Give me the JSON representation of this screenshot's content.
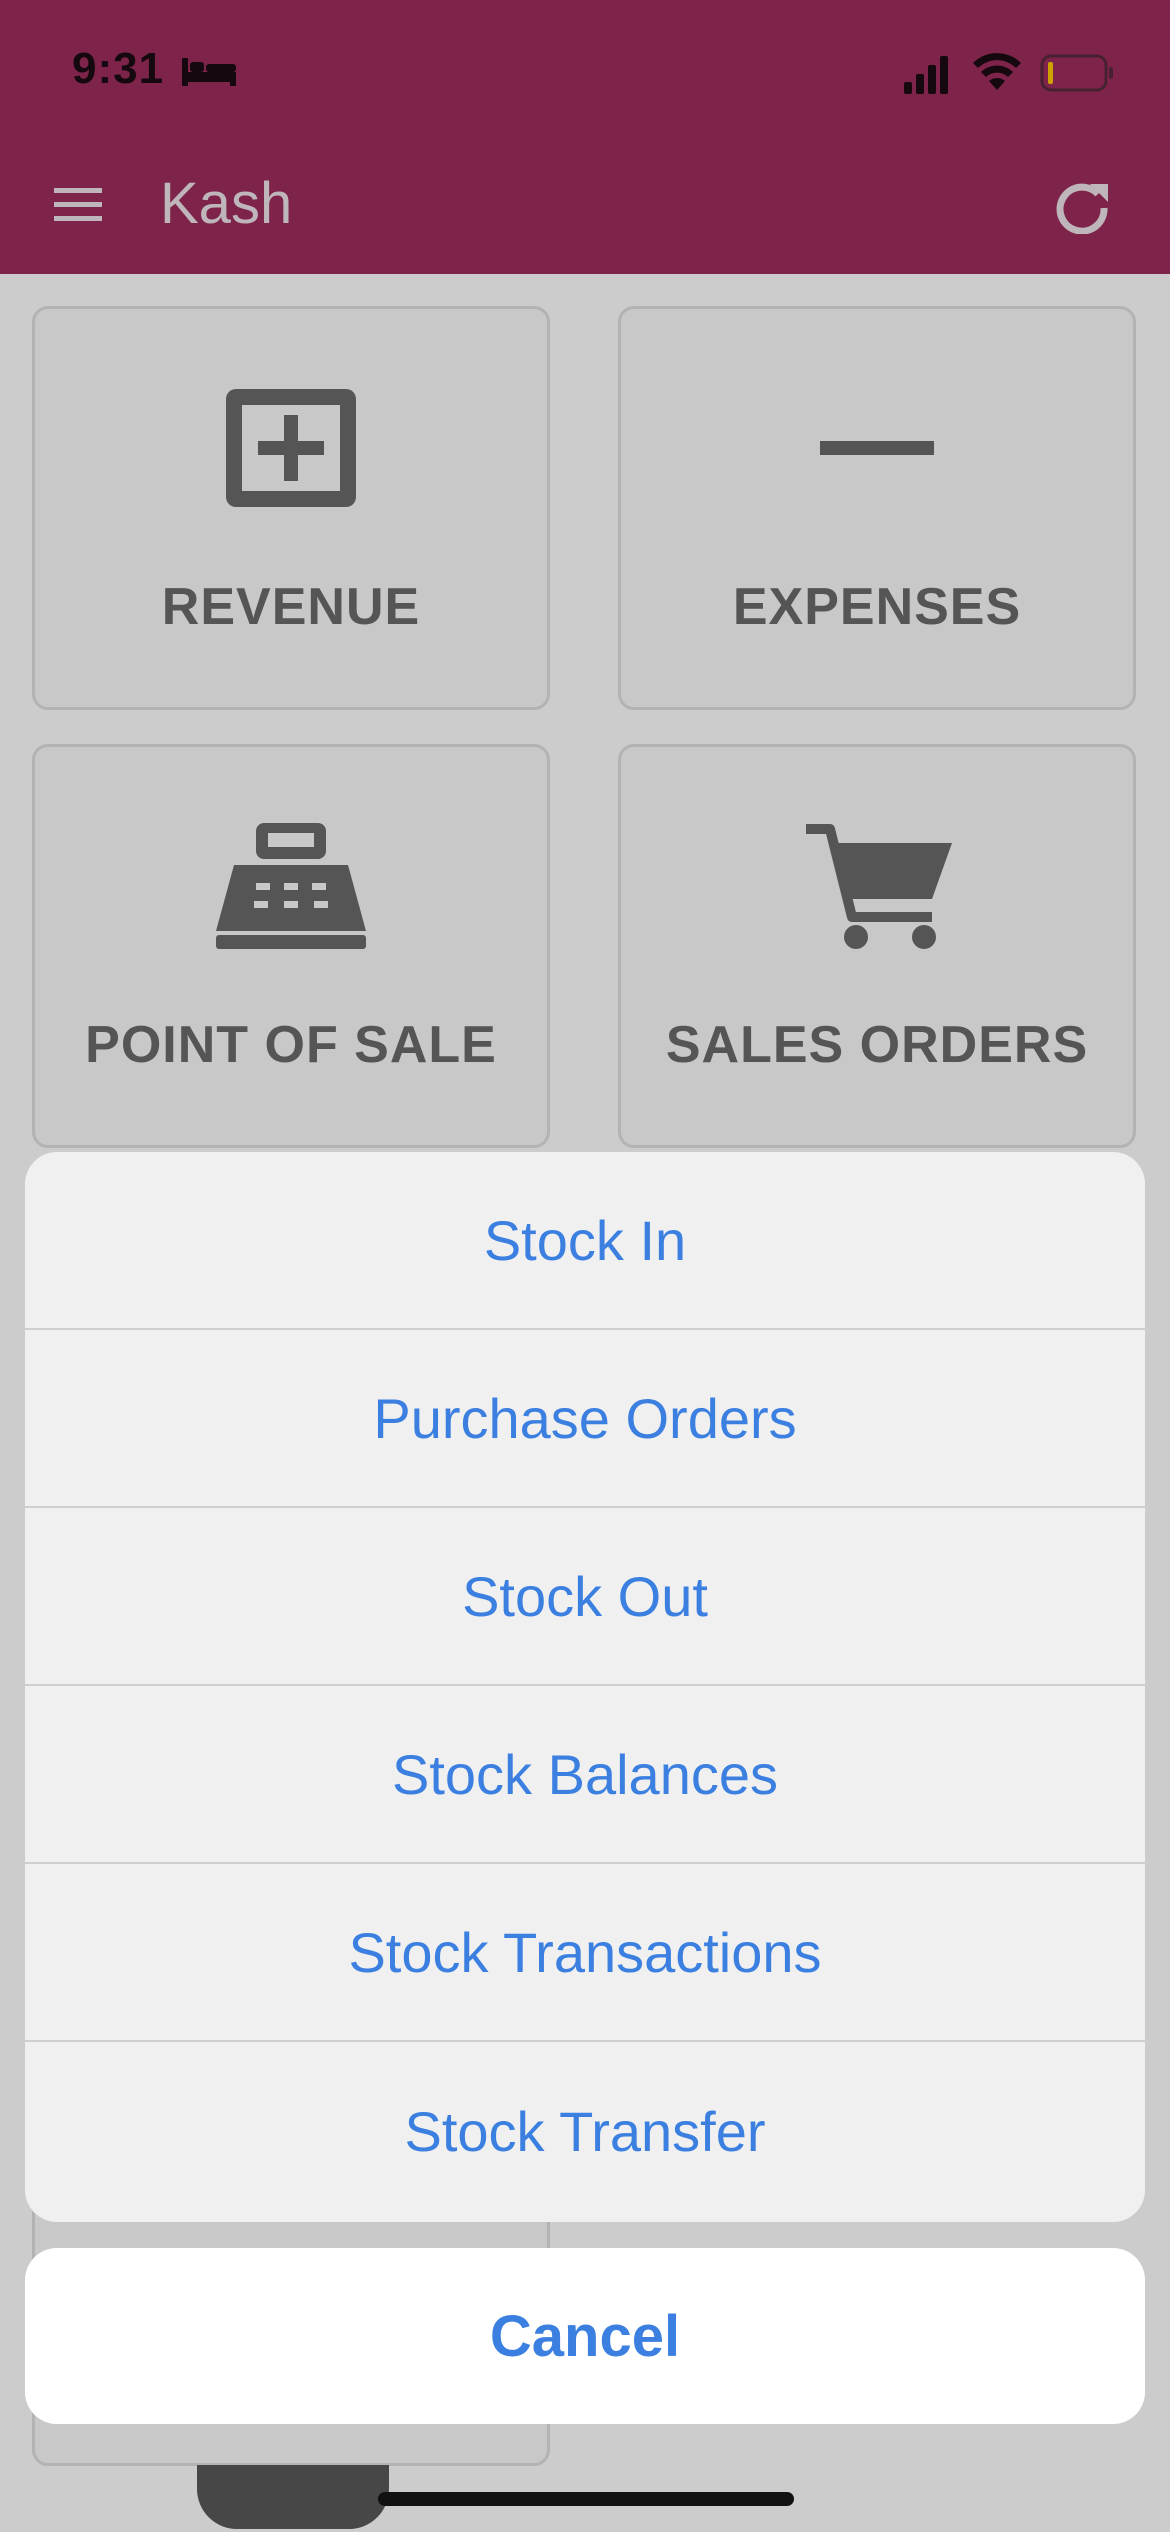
{
  "status_bar": {
    "time": "9:31",
    "icons": [
      "bed-icon",
      "signal-icon",
      "wifi-icon",
      "battery-icon"
    ]
  },
  "app_bar": {
    "title": "Kash",
    "menu_icon": "menu-icon",
    "refresh_icon": "refresh-icon"
  },
  "tiles": [
    {
      "label": "REVENUE",
      "icon": "plus-box-icon"
    },
    {
      "label": "EXPENSES",
      "icon": "minus-icon"
    },
    {
      "label": "POINT OF SALE",
      "icon": "cash-register-icon"
    },
    {
      "label": "SALES ORDERS",
      "icon": "cart-icon"
    }
  ],
  "action_sheet": {
    "items": [
      "Stock In",
      "Purchase Orders",
      "Stock Out",
      "Stock Balances",
      "Stock Transactions",
      "Stock Transfer"
    ],
    "cancel_label": "Cancel"
  },
  "colors": {
    "brand": "#9e2d5d",
    "action_text": "#3b7fe0",
    "tile_text": "#6b6b6b"
  }
}
